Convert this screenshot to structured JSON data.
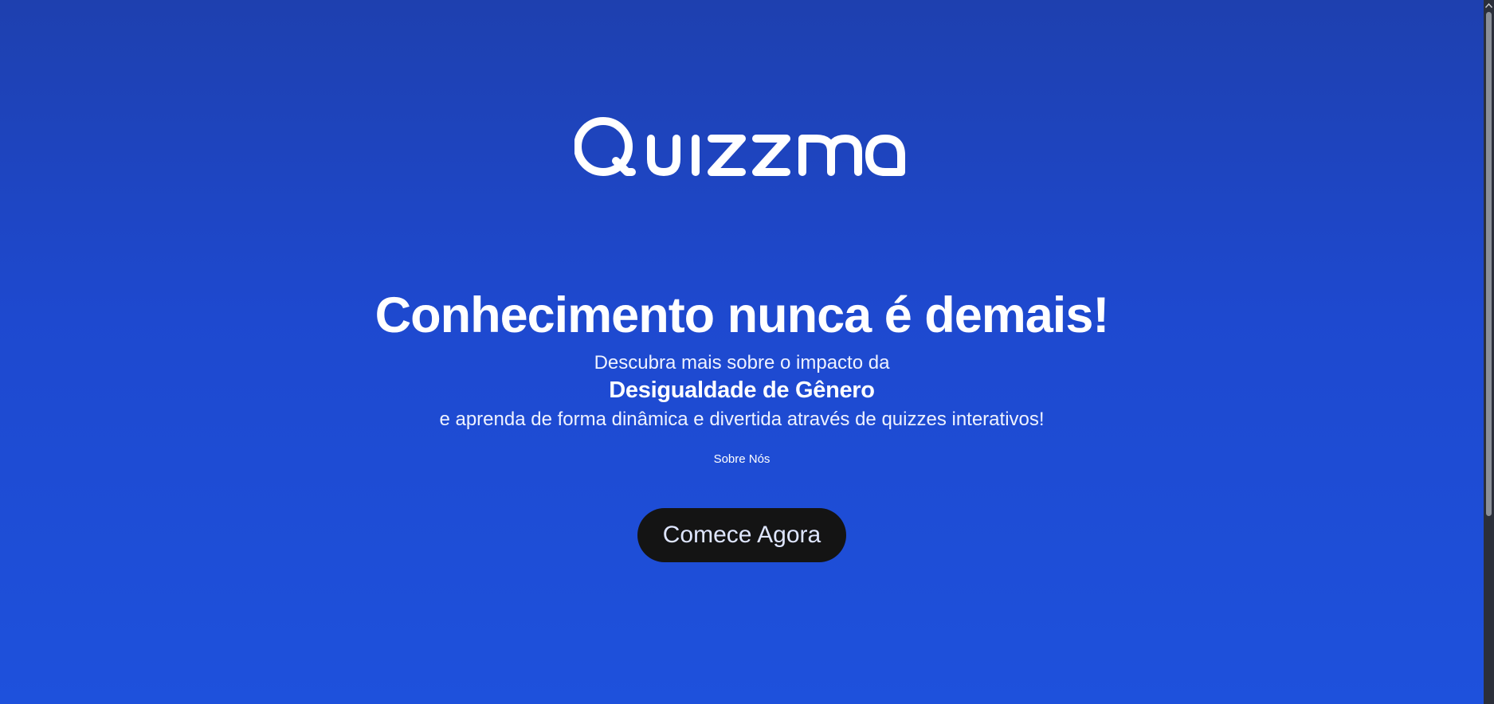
{
  "brand": {
    "logo_text": "Quizzma",
    "logo_icon": "quizzma-wordmark"
  },
  "hero": {
    "headline": "Conhecimento nunca é demais!",
    "line1": "Descubra mais sobre o impacto da",
    "highlight": "Desigualdade de Gênero",
    "line2": "e aprenda de forma dinâmica e divertida através de quizzes interativos!",
    "about_link": "Sobre Nós",
    "cta_label": "Comece Agora"
  },
  "colors": {
    "background_top": "#1e40af",
    "background_bottom": "#1e51dc",
    "button_bg": "#141414",
    "button_text": "#dfe6ff",
    "text": "#ffffff"
  },
  "scrollbar": {
    "up_icon": "scroll-up-arrow-icon"
  }
}
